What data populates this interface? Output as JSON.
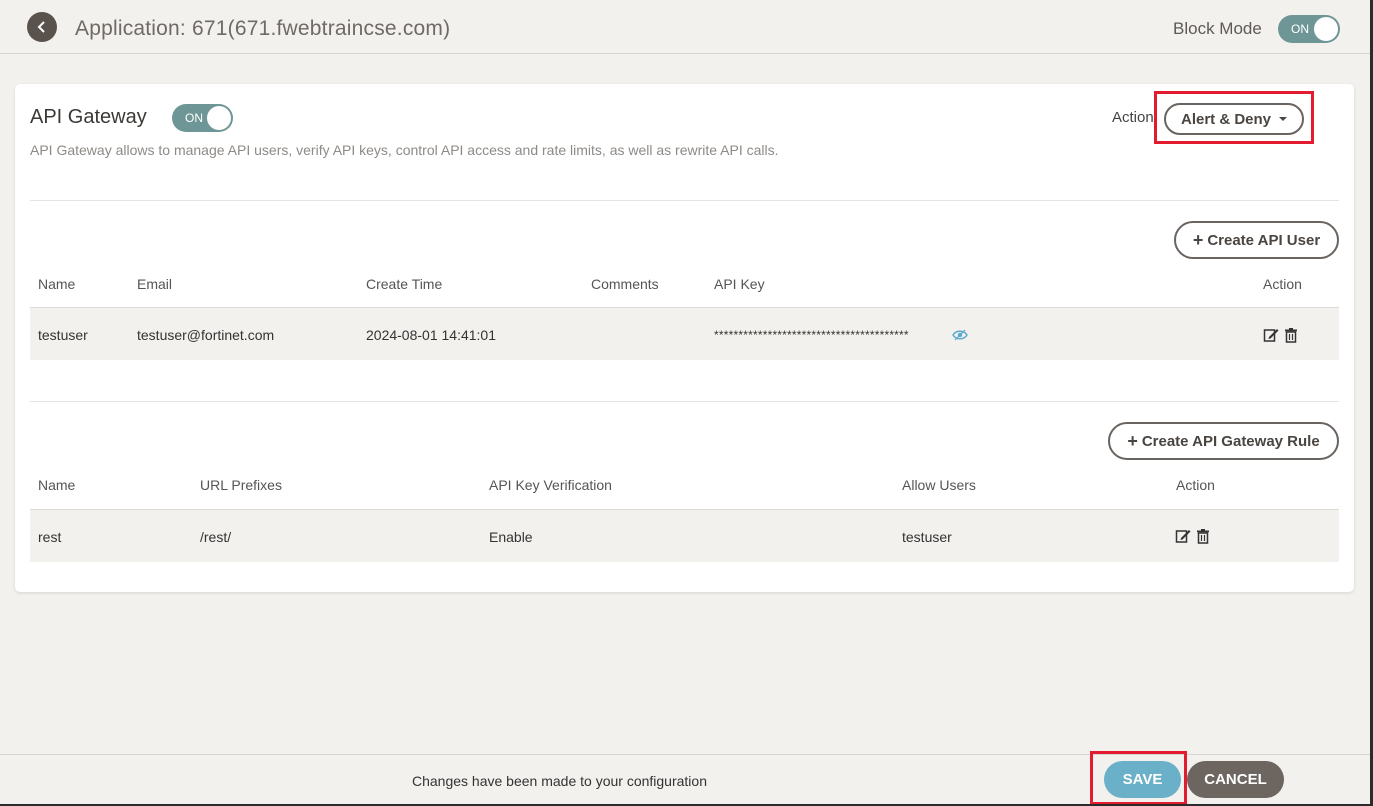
{
  "header": {
    "title": "Application: 671(671.fwebtraincse.com)",
    "block_mode_label": "Block Mode",
    "block_mode_toggle": "ON"
  },
  "card": {
    "title": "API Gateway",
    "toggle": "ON",
    "description": "API Gateway allows to manage API users, verify API keys, control API access and rate limits, as well as rewrite API calls.",
    "action_label": "Action",
    "action_value": "Alert & Deny"
  },
  "users": {
    "create_button": "Create API User",
    "columns": [
      "Name",
      "Email",
      "Create Time",
      "Comments",
      "API Key",
      "Action"
    ],
    "rows": [
      {
        "name": "testuser",
        "email": "testuser@fortinet.com",
        "create_time": "2024-08-01 14:41:01",
        "comments": "",
        "api_key": "****************************************"
      }
    ]
  },
  "rules": {
    "create_button": "Create API Gateway Rule",
    "columns": [
      "Name",
      "URL Prefixes",
      "API Key Verification",
      "Allow Users",
      "Action"
    ],
    "rows": [
      {
        "name": "rest",
        "url_prefixes": "/rest/",
        "api_key_verification": "Enable",
        "allow_users": "testuser"
      }
    ]
  },
  "footer": {
    "message": "Changes have been made to your configuration",
    "save_label": "SAVE",
    "cancel_label": "CANCEL"
  },
  "icons": {
    "back": "chevron-left-icon",
    "plus": "plus-icon",
    "edit": "edit-icon",
    "delete": "trash-icon",
    "reveal": "eye-icon"
  },
  "colors": {
    "toggle_on": "#6f9696",
    "save": "#6ab0c9",
    "cancel": "#6c6560",
    "highlight": "#e21b2e"
  }
}
